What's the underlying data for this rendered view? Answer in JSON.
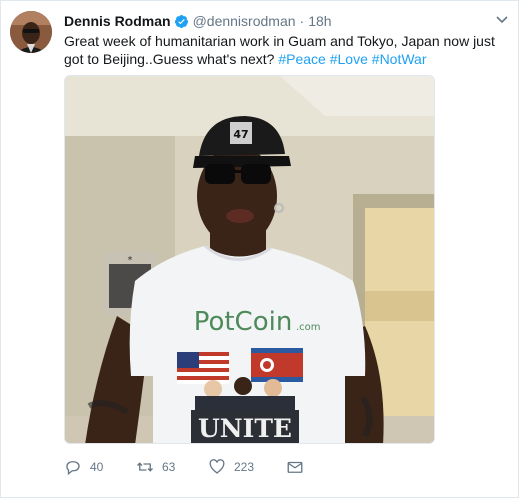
{
  "tweet": {
    "author_name": "Dennis Rodman",
    "handle": "@dennisrodman",
    "separator": "·",
    "time": "18h",
    "text": "Great week of humanitarian work in Guam and Tokyo, Japan now just got to Beijing..Guess what's next?",
    "hashtags": [
      "#Peace",
      "#Love",
      "#NotWar"
    ],
    "replies": "40",
    "retweets": "63",
    "likes": "223"
  },
  "photo": {
    "shirt_brand": "PotCoin",
    "shirt_brand_suffix": ".com",
    "shirt_slogan": "UNITE",
    "cap_text": "47"
  },
  "colors": {
    "hashtag": "#1da1f2",
    "verified": "#1da1f2",
    "muted": "#657786"
  },
  "icons": [
    "verified-badge-icon",
    "caret-down-icon",
    "reply-icon",
    "retweet-icon",
    "like-icon",
    "message-icon"
  ]
}
